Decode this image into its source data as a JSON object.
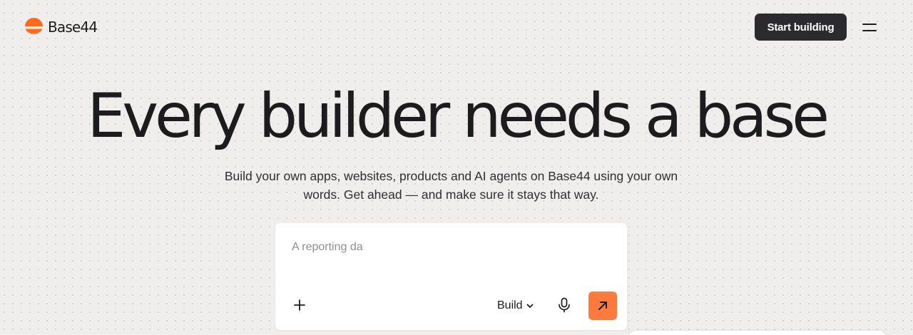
{
  "brand": {
    "name": "Base44",
    "logo_icon": "half-sun-logo",
    "accent_color": "#ff6b1a"
  },
  "header": {
    "start_button_label": "Start building",
    "menu_icon": "hamburger-menu-icon"
  },
  "hero": {
    "headline": "Every builder needs a base",
    "subtitle": "Build your own apps, websites, products and AI agents on Base44 using your own words. Get ahead — and make sure it stays that way."
  },
  "prompt": {
    "placeholder": "A reporting da",
    "value": "",
    "mode_label": "Build",
    "add_icon": "plus-icon",
    "mode_chevron_icon": "chevron-down-icon",
    "mic_icon": "microphone-icon",
    "send_icon": "arrow-up-right-icon",
    "send_color": "#ff7a3d"
  }
}
